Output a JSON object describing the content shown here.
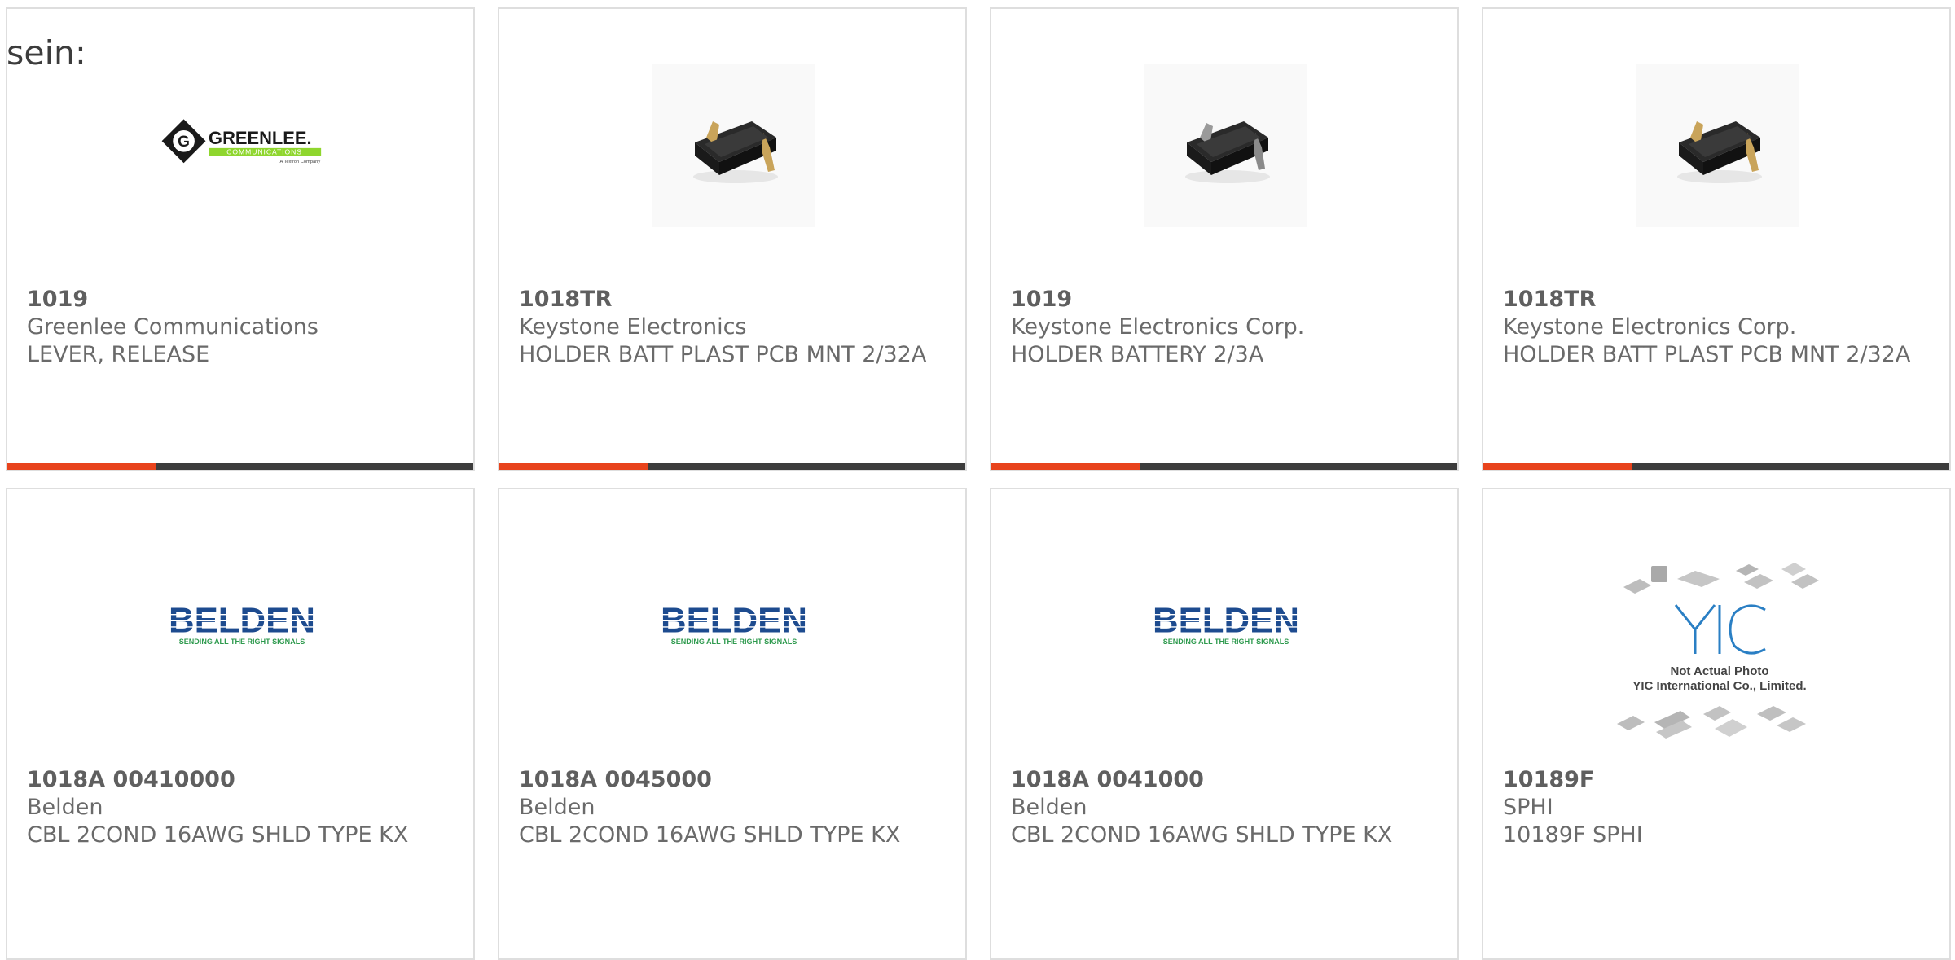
{
  "intro_text": "sein:",
  "colors": {
    "accent": "#e8431c",
    "bar_dark": "#3c3c3c",
    "card_border": "#dedede",
    "text": "#6a6a6a"
  },
  "products": [
    {
      "part": "1019",
      "manufacturer": "Greenlee Communications",
      "description": "LEVER, RELEASE",
      "image": "greenlee-logo"
    },
    {
      "part": "1018TR",
      "manufacturer": "Keystone Electronics",
      "description": "HOLDER BATT PLAST PCB MNT 2/32A",
      "image": "battery-holder-photo"
    },
    {
      "part": "1019",
      "manufacturer": "Keystone Electronics Corp.",
      "description": "HOLDER BATTERY 2/3A",
      "image": "battery-holder-photo"
    },
    {
      "part": "1018TR",
      "manufacturer": "Keystone Electronics Corp.",
      "description": "HOLDER BATT PLAST PCB MNT 2/32A",
      "image": "battery-holder-photo"
    },
    {
      "part": "1018A 00410000",
      "manufacturer": "Belden",
      "description": "CBL 2COND 16AWG SHLD TYPE KX",
      "image": "belden-logo"
    },
    {
      "part": "1018A 0045000",
      "manufacturer": "Belden",
      "description": "CBL 2COND 16AWG SHLD TYPE KX",
      "image": "belden-logo"
    },
    {
      "part": "1018A 0041000",
      "manufacturer": "Belden",
      "description": "CBL 2COND 16AWG SHLD TYPE KX",
      "image": "belden-logo"
    },
    {
      "part": "10189F",
      "manufacturer": "SPHI",
      "description": "10189F SPHI",
      "image": "yic-not-actual-photo"
    }
  ],
  "logos": {
    "greenlee_name": "GREENLEE.",
    "greenlee_sub": "COMMUNICATIONS",
    "greenlee_tag": "A Textron Company",
    "belden_name": "BELDEN",
    "belden_tag": "SENDING ALL THE RIGHT SIGNALS",
    "yic_line1": "Not Actual Photo",
    "yic_line2": "YIC International Co., Limited."
  }
}
